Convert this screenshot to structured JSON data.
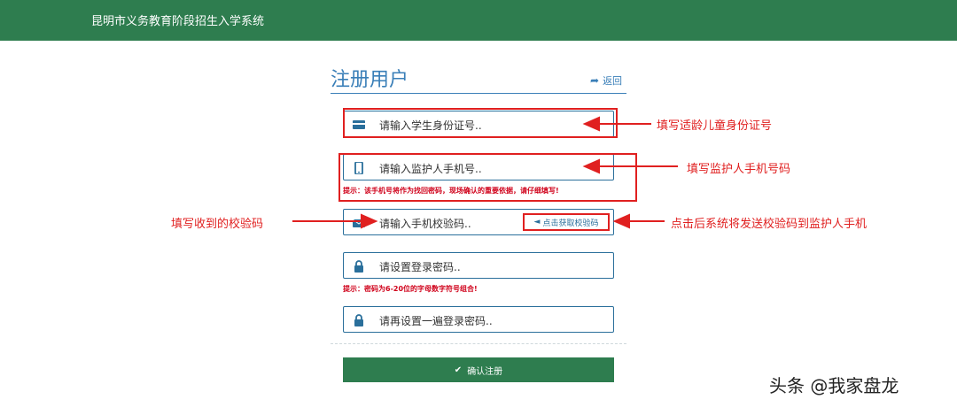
{
  "header": {
    "app_title": "昆明市义务教育阶段招生入学系统"
  },
  "form": {
    "title": "注册用户",
    "back_label": "返回",
    "student_id_placeholder": "请输入学生身份证号..",
    "guardian_phone_placeholder": "请输入监护人手机号..",
    "phone_hint": "提示：该手机号将作为找回密码，现场确认的重要依据，请仔细填写!",
    "sms_code_placeholder": "请输入手机校验码..",
    "get_code_label": "点击获取校验码",
    "password_placeholder": "请设置登录密码..",
    "password_hint": "提示：密码为6-20位的字母数字符号组合!",
    "confirm_password_placeholder": "请再设置一遍登录密码..",
    "submit_label": "确认注册"
  },
  "annotations": {
    "student_id": "填写适龄儿童身份证号",
    "guardian_phone": "填写监护人手机号码",
    "sms_code": "填写收到的校验码",
    "get_code": "点击后系统将发送校验码到监护人手机"
  },
  "watermark": "头条 @我家盘龙",
  "colors": {
    "header_green": "#2e7d4f",
    "accent_blue": "#2a6f9b",
    "annotation_red": "#e02020"
  }
}
